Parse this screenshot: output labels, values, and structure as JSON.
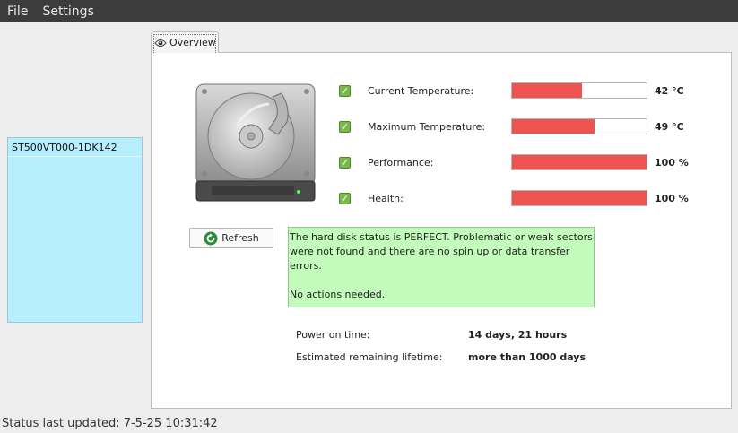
{
  "menu": {
    "file": "File",
    "settings": "Settings"
  },
  "devices": {
    "items": [
      {
        "label": "ST500VT000-1DK142"
      }
    ]
  },
  "tabs": {
    "overview": "Overview"
  },
  "metrics": [
    {
      "label": "Current Temperature:",
      "value": "42 °C",
      "level": 0.52
    },
    {
      "label": "Maximum Temperature:",
      "value": "49 °C",
      "level": 0.61
    },
    {
      "label": "Performance:",
      "value": "100 %",
      "level": 1.0
    },
    {
      "label": "Health:",
      "value": "100 %",
      "level": 1.0
    }
  ],
  "refresh_label": "Refresh",
  "status_message": {
    "line1": "The hard disk status is PERFECT. Problematic or weak sectors were not found and there are no spin up or data transfer errors.",
    "line2": "No actions needed."
  },
  "info": {
    "power_on_label": "Power on time:",
    "power_on_value": "14 days, 21 hours",
    "lifetime_label": "Estimated remaining lifetime:",
    "lifetime_value": "more than 1000 days"
  },
  "statusbar": {
    "text": "Status last updated: 7-5-25 10:31:42"
  },
  "colors": {
    "bar_fill": "#ef5350",
    "status_bg": "#c3fbbd",
    "device_list_bg": "#b7efff",
    "check": "#7ab84a"
  }
}
